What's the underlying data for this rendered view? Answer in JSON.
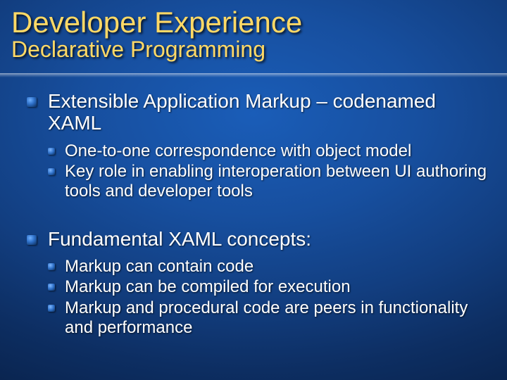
{
  "title": "Developer Experience",
  "subtitle": "Declarative Programming",
  "bullets": [
    {
      "text": "Extensible Application Markup – codenamed XAML",
      "children": [
        "One-to-one correspondence with object model",
        "Key role in enabling interoperation between UI authoring tools and developer tools"
      ]
    },
    {
      "text": "Fundamental XAML concepts:",
      "children": [
        "Markup can contain code",
        "Markup can be compiled for execution",
        "Markup and procedural code are peers in functionality and performance"
      ]
    }
  ]
}
